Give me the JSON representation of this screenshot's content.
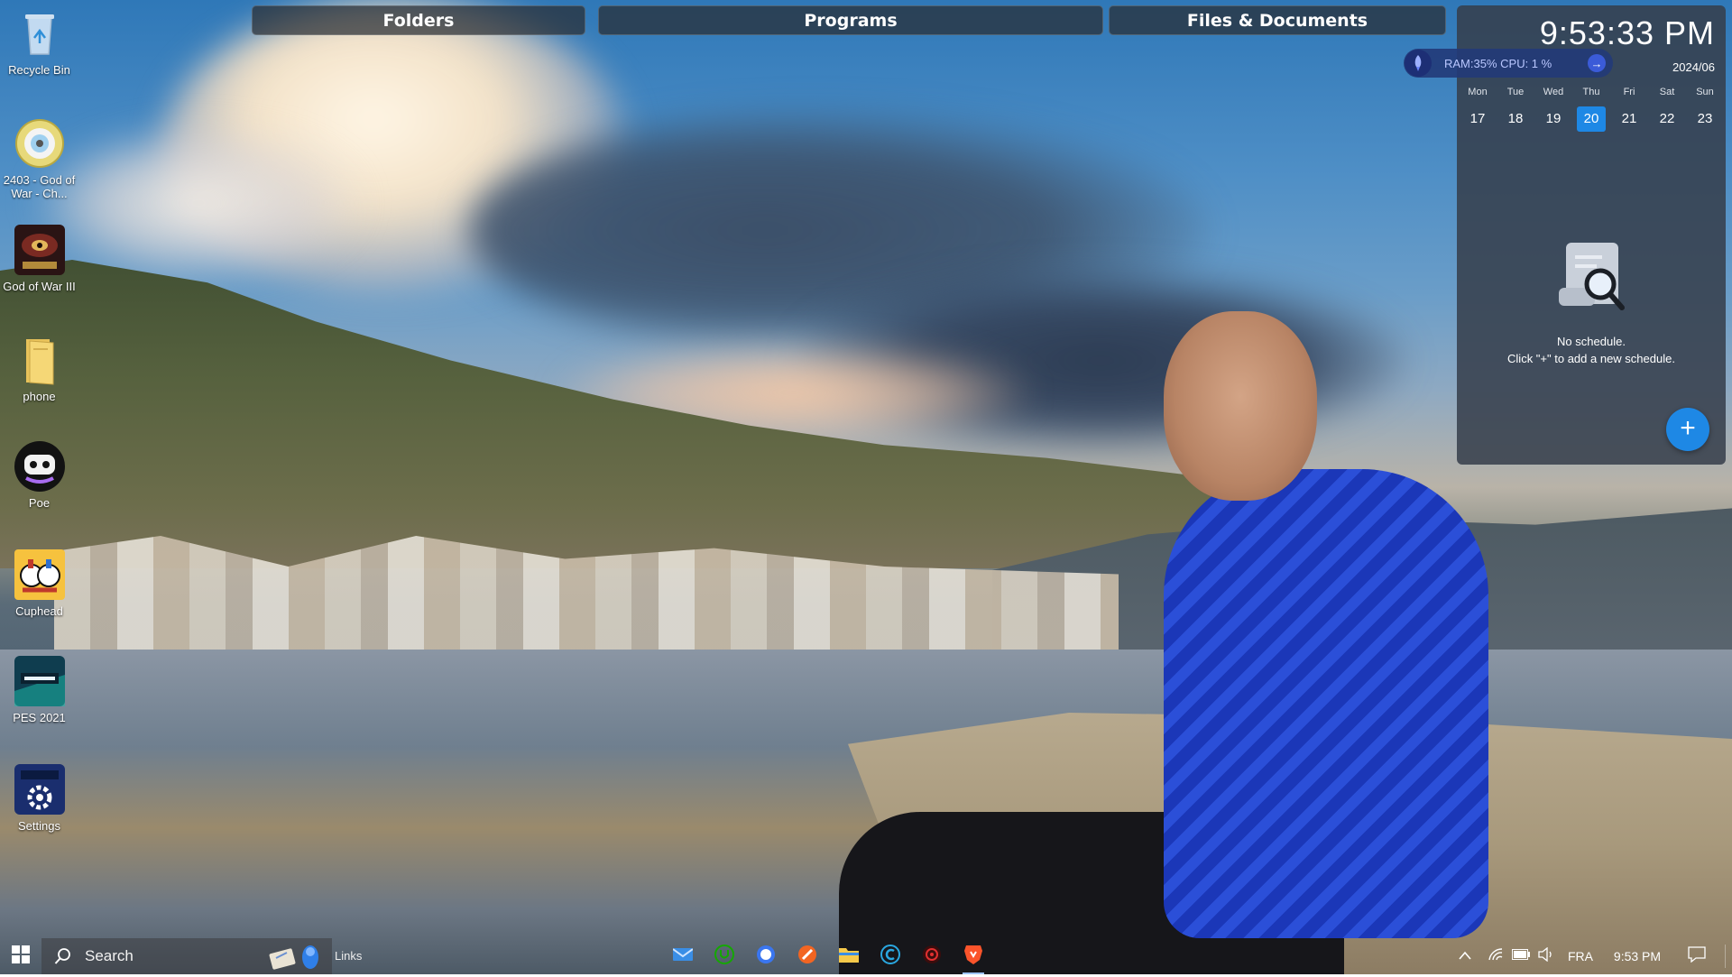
{
  "top_tabs": [
    {
      "label": "Folders"
    },
    {
      "label": "Programs"
    },
    {
      "label": "Files & Documents"
    }
  ],
  "desktop_icons": [
    {
      "label": "Recycle Bin",
      "icon": "recycle-bin-icon"
    },
    {
      "label": "2403 - God of War - Ch...",
      "icon": "disc-icon"
    },
    {
      "label": "God of War III",
      "icon": "god-of-war-icon"
    },
    {
      "label": "phone",
      "icon": "folder-icon"
    },
    {
      "label": "Poe",
      "icon": "poe-robot-icon"
    },
    {
      "label": "Cuphead",
      "icon": "cuphead-icon"
    },
    {
      "label": "PES 2021",
      "icon": "pes-2021-icon"
    },
    {
      "label": "Settings",
      "icon": "pes-settings-icon"
    }
  ],
  "widget": {
    "clock": "9:53:33 PM",
    "year_month": "2024/06",
    "stats": "RAM:35%  CPU: 1 %",
    "week": [
      {
        "name": "Mon",
        "day": "17"
      },
      {
        "name": "Tue",
        "day": "18"
      },
      {
        "name": "Wed",
        "day": "19"
      },
      {
        "name": "Thu",
        "day": "20",
        "today": true
      },
      {
        "name": "Fri",
        "day": "21"
      },
      {
        "name": "Sat",
        "day": "22"
      },
      {
        "name": "Sun",
        "day": "23"
      }
    ],
    "empty_title": "No schedule.",
    "empty_hint": "Click \"+\" to add a new schedule.",
    "add_label": "+"
  },
  "taskbar": {
    "search_placeholder": "Search",
    "links_label": "Links",
    "apps": [
      {
        "icon": "mail-icon"
      },
      {
        "icon": "upwork-icon"
      },
      {
        "icon": "signal-icon"
      },
      {
        "icon": "pen-app-icon"
      },
      {
        "icon": "file-explorer-icon"
      },
      {
        "icon": "ccleaner-icon"
      },
      {
        "icon": "game-launcher-icon"
      },
      {
        "icon": "brave-browser-icon",
        "active": true
      }
    ],
    "tray": {
      "language": "FRA",
      "time": "9:53 PM"
    }
  },
  "colors": {
    "accent": "#1e88e5",
    "widget_bg": "#363e4a",
    "stats_pill": "#223a78"
  }
}
